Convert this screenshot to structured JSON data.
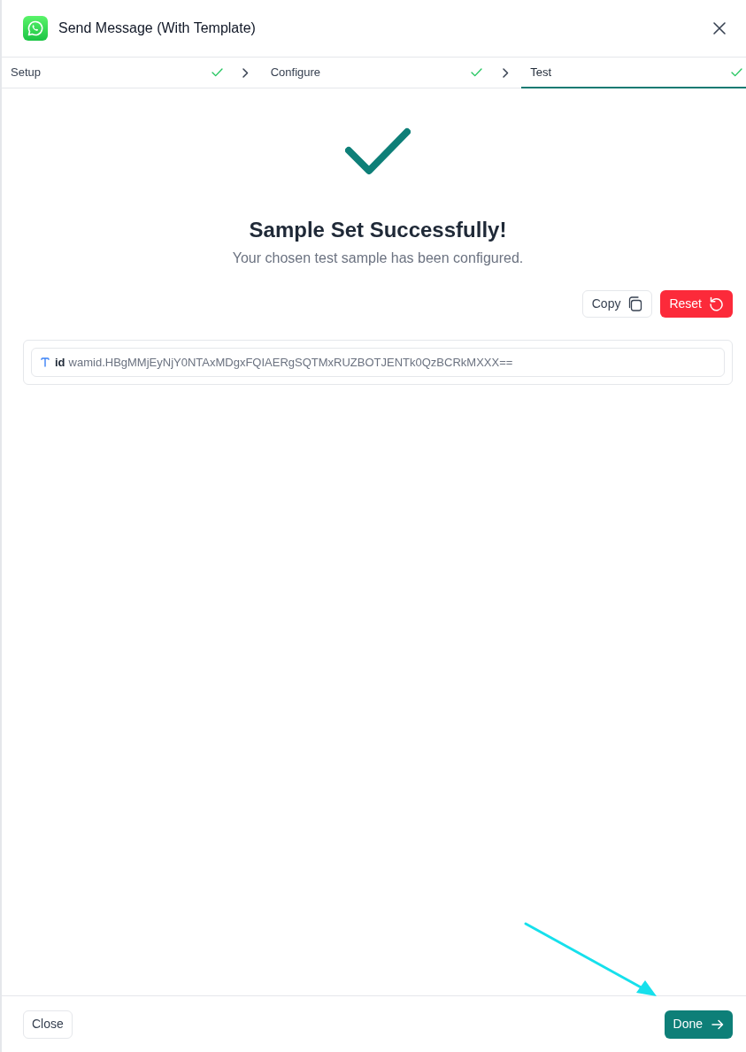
{
  "window": {
    "title": "Send Message (With Template)"
  },
  "steps": [
    {
      "label": "Setup",
      "completed": true,
      "selected": false
    },
    {
      "label": "Configure",
      "completed": true,
      "selected": false
    },
    {
      "label": "Test",
      "completed": true,
      "selected": true
    }
  ],
  "result": {
    "title": "Sample Set Successfully!",
    "message": "Your chosen test sample has been configured."
  },
  "actions": [
    {
      "label": "Copy",
      "kind": "copy"
    },
    {
      "label": "Reset",
      "kind": "reset"
    }
  ],
  "fields": [
    {
      "name": "id",
      "kind": "text",
      "value": "wamid.HBgMMjEyNjY0NTAxMDgxFQIAERgSQTMxRUZBOTJENTk0QzBCRkMXXX=="
    }
  ],
  "footer": {
    "buttons": [
      {
        "label": "Close",
        "kind": "secondary"
      },
      {
        "label": "Done",
        "kind": "primary"
      }
    ]
  }
}
